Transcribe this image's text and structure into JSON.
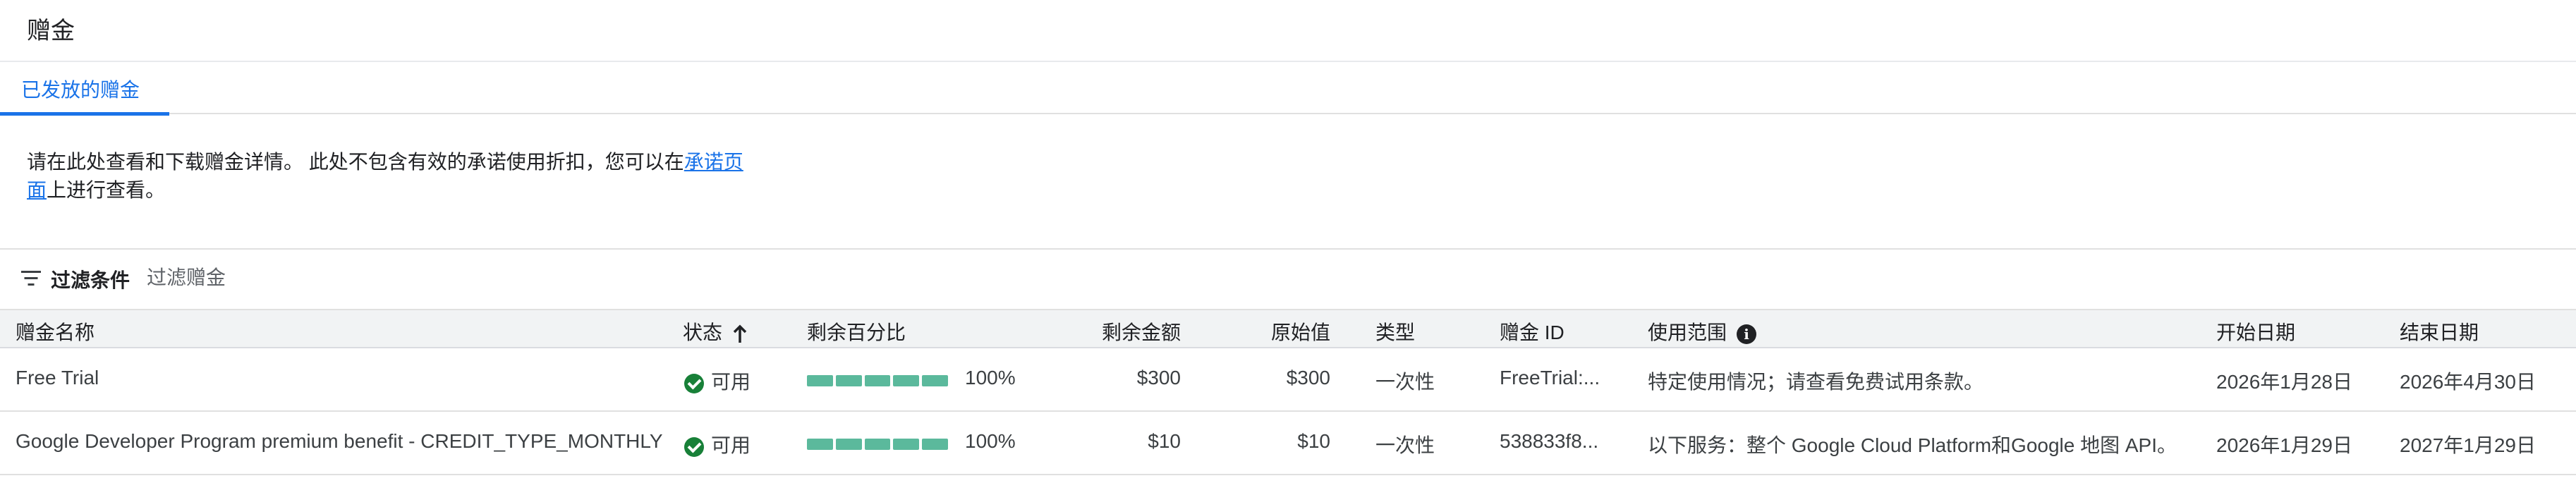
{
  "page": {
    "title": "赠金"
  },
  "tabs": [
    {
      "label": "已发放的赠金"
    }
  ],
  "notice": {
    "text_before": "请在此处查看和下载赠金详情。 此处不包含有效的承诺使用折扣，您可以在",
    "link": "承诺页面",
    "text_after": "上进行查看。"
  },
  "filter": {
    "label": "过滤条件",
    "placeholder": "过滤赠金"
  },
  "table": {
    "columns": {
      "name": "赠金名称",
      "status": "状态",
      "remaining_pct": "剩余百分比",
      "remaining_amount": "剩余金额",
      "original_value": "原始值",
      "type": "类型",
      "credit_id": "赠金 ID",
      "scope": "使用范围",
      "start_date": "开始日期",
      "end_date": "结束日期"
    },
    "sort": {
      "column": "status",
      "direction": "ascending",
      "icon": "arrow-up-icon"
    },
    "rows": [
      {
        "name": "Free Trial",
        "status": "可用",
        "remaining_pct_label": "100%",
        "remaining_fraction": 1.0,
        "remaining_amount": "$300",
        "original_value": "$300",
        "type": "一次性",
        "credit_id": "FreeTrial:...",
        "scope": "特定使用情况；请查看免费试用条款。",
        "start_date": "2026年1月28日",
        "end_date": "2026年4月30日"
      },
      {
        "name": "Google Developer Program premium benefit - CREDIT_TYPE_MONTHLY",
        "status": "可用",
        "remaining_pct_label": "100%",
        "remaining_fraction": 1.0,
        "remaining_amount": "$10",
        "original_value": "$10",
        "type": "一次性",
        "credit_id": "538833f8...",
        "scope": "以下服务：整个 Google Cloud Platform和Google 地图 API。",
        "start_date": "2026年1月29日",
        "end_date": "2027年1月29日"
      }
    ]
  },
  "colors": {
    "accent": "#1a73e8",
    "status_ok": "#188038",
    "progress": "#5bb99c"
  },
  "icons": [
    "filter-icon",
    "arrow-up-icon",
    "info-icon",
    "check-circle-icon"
  ]
}
